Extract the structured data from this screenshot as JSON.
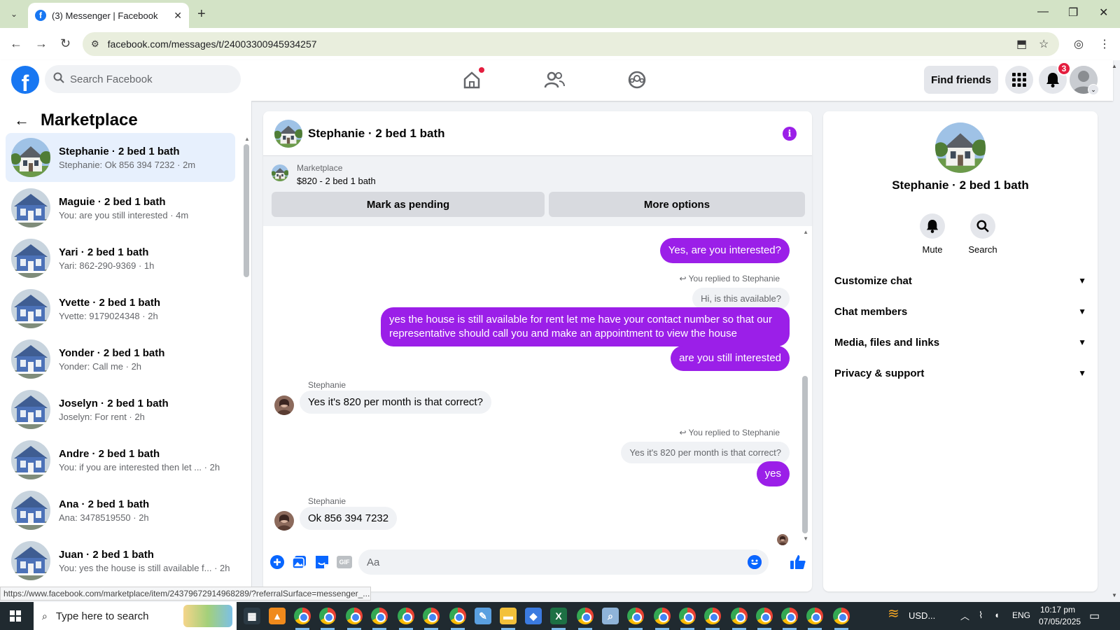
{
  "browser": {
    "tab_title": "(3) Messenger | Facebook",
    "url": "facebook.com/messages/t/24003300945934257"
  },
  "fb": {
    "search_placeholder": "Search Facebook",
    "find_friends": "Find friends",
    "notification_count": "3",
    "logo_letter": "f"
  },
  "sidebar": {
    "title": "Marketplace",
    "conversations": [
      {
        "name": "Stephanie · 2 bed 1 bath",
        "snippet": "Stephanie: Ok 856 394 7232 · 2m",
        "active": true
      },
      {
        "name": "Maguie · 2 bed 1 bath",
        "snippet": "You: are you still interested · 4m"
      },
      {
        "name": "Yari · 2 bed 1 bath",
        "snippet": "Yari: 862-290-9369 · 1h"
      },
      {
        "name": "Yvette · 2 bed 1 bath",
        "snippet": "Yvette: 9179024348 · 2h"
      },
      {
        "name": "Yonder · 2 bed 1 bath",
        "snippet": "Yonder: Call me · 2h"
      },
      {
        "name": "Joselyn · 2 bed 1 bath",
        "snippet": "Joselyn: For rent · 2h"
      },
      {
        "name": "Andre · 2 bed 1 bath",
        "snippet": "You: if you are interested then let ... · 2h"
      },
      {
        "name": "Ana · 2 bed 1 bath",
        "snippet": "Ana: 3478519550 · 2h"
      },
      {
        "name": "Juan · 2 bed 1 bath",
        "snippet": "You: yes the house is still available f... · 2h"
      }
    ]
  },
  "chat": {
    "title": "Stephanie · 2 bed 1 bath",
    "marketplace_label": "Marketplace",
    "listing": "$820 - 2 bed 1 bath",
    "mark_pending": "Mark as pending",
    "more_options": "More options",
    "messages": {
      "out1": "Yes, are you interested?",
      "reply_label1": "You replied to Stephanie",
      "quoted1": "Hi, is this available?",
      "out2": "yes the house is still available for rent let me have your contact number so that our representative should call you and make an appointment to view the house",
      "out3": "are you still interested",
      "sender1": "Stephanie",
      "in1": "Yes it's 820 per month is that correct?",
      "reply_label2": "You replied to Stephanie",
      "quoted2": "Yes it's 820 per month is that correct?",
      "out4": "yes",
      "sender2": "Stephanie",
      "in2": "Ok 856 394 7232"
    },
    "composer_placeholder": "Aa",
    "gif_label": "GIF"
  },
  "info_panel": {
    "name": "Stephanie · 2 bed 1 bath",
    "mute": "Mute",
    "search": "Search",
    "sections": [
      "Customize chat",
      "Chat members",
      "Media, files and links",
      "Privacy & support"
    ]
  },
  "status_url": "https://www.facebook.com/marketplace/item/24379672914968289/?referralSurface=messenger_...",
  "taskbar": {
    "search_placeholder": "Type here to search",
    "currency": "USD...",
    "lang": "ENG",
    "time": "10:17 pm",
    "date": "07/05/2025"
  },
  "colors": {
    "messenger_purple": "#9b1fe8",
    "fb_blue": "#1877f2",
    "badge_red": "#e41e3f"
  }
}
